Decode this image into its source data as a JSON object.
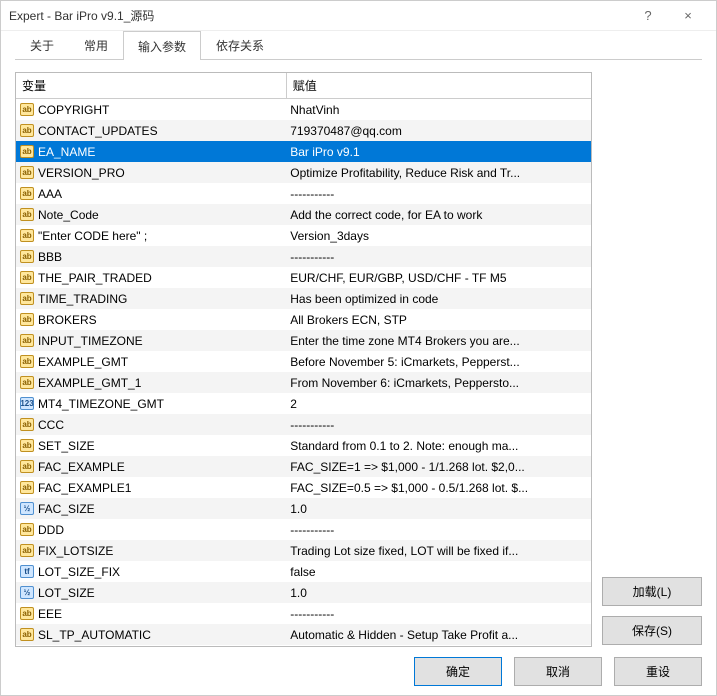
{
  "window": {
    "title": "Expert - Bar iPro v9.1_源码",
    "help": "?",
    "close": "×"
  },
  "tabs": {
    "items": [
      {
        "label": "关于"
      },
      {
        "label": "常用"
      },
      {
        "label": "输入参数"
      },
      {
        "label": "依存关系"
      }
    ],
    "activeIndex": 2
  },
  "table": {
    "headers": {
      "variable": "变量",
      "value": "赋值"
    },
    "rows": [
      {
        "icon": "ab",
        "var": "COPYRIGHT",
        "val": "NhatVinh"
      },
      {
        "icon": "ab",
        "var": "CONTACT_UPDATES",
        "val": "719370487@qq.com"
      },
      {
        "icon": "ab",
        "var": "EA_NAME",
        "val": "Bar iPro v9.1",
        "selected": true
      },
      {
        "icon": "ab",
        "var": "VERSION_PRO",
        "val": "Optimize Profitability, Reduce Risk and Tr..."
      },
      {
        "icon": "ab",
        "var": "AAA",
        "val": "-----------"
      },
      {
        "icon": "ab",
        "var": "Note_Code",
        "val": "Add the correct code, for EA to work"
      },
      {
        "icon": "ab",
        "var": "\"Enter CODE here\"  ;",
        "val": "Version_3days"
      },
      {
        "icon": "ab",
        "var": "BBB",
        "val": "-----------"
      },
      {
        "icon": "ab",
        "var": "THE_PAIR_TRADED",
        "val": "EUR/CHF, EUR/GBP, USD/CHF - TF M5"
      },
      {
        "icon": "ab",
        "var": "TIME_TRADING",
        "val": "Has been optimized in code"
      },
      {
        "icon": "ab",
        "var": "BROKERS",
        "val": "All Brokers ECN, STP"
      },
      {
        "icon": "ab",
        "var": "INPUT_TIMEZONE",
        "val": "Enter the time zone MT4 Brokers you are..."
      },
      {
        "icon": "ab",
        "var": "EXAMPLE_GMT",
        "val": "Before November 5: iCmarkets, Pepperst..."
      },
      {
        "icon": "ab",
        "var": "EXAMPLE_GMT_1",
        "val": "From November 6: iCmarkets, Peppersto..."
      },
      {
        "icon": "123",
        "var": "MT4_TIMEZONE_GMT",
        "val": "2"
      },
      {
        "icon": "ab",
        "var": "CCC",
        "val": "-----------"
      },
      {
        "icon": "ab",
        "var": "SET_SIZE",
        "val": "Standard from 0.1 to 2. Note: enough ma..."
      },
      {
        "icon": "ab",
        "var": "FAC_EXAMPLE",
        "val": "FAC_SIZE=1 => $1,000 - 1/1.268 lot. $2,0..."
      },
      {
        "icon": "ab",
        "var": "FAC_EXAMPLE1",
        "val": "FAC_SIZE=0.5 => $1,000 - 0.5/1.268 lot. $..."
      },
      {
        "icon": "num",
        "var": "FAC_SIZE",
        "val": "1.0"
      },
      {
        "icon": "ab",
        "var": "DDD",
        "val": "-----------"
      },
      {
        "icon": "ab",
        "var": "FIX_LOTSIZE",
        "val": "Trading Lot size fixed, LOT will be fixed if..."
      },
      {
        "icon": "tf",
        "var": "LOT_SIZE_FIX",
        "val": "false"
      },
      {
        "icon": "num",
        "var": "LOT_SIZE",
        "val": "1.0"
      },
      {
        "icon": "ab",
        "var": "EEE",
        "val": "-----------"
      },
      {
        "icon": "ab",
        "var": "SL_TP_AUTOMATIC",
        "val": "Automatic & Hidden - Setup Take Profit a..."
      }
    ]
  },
  "sideButtons": {
    "load": "加载(L)",
    "save": "保存(S)"
  },
  "footer": {
    "ok": "确定",
    "cancel": "取消",
    "reset": "重设"
  }
}
